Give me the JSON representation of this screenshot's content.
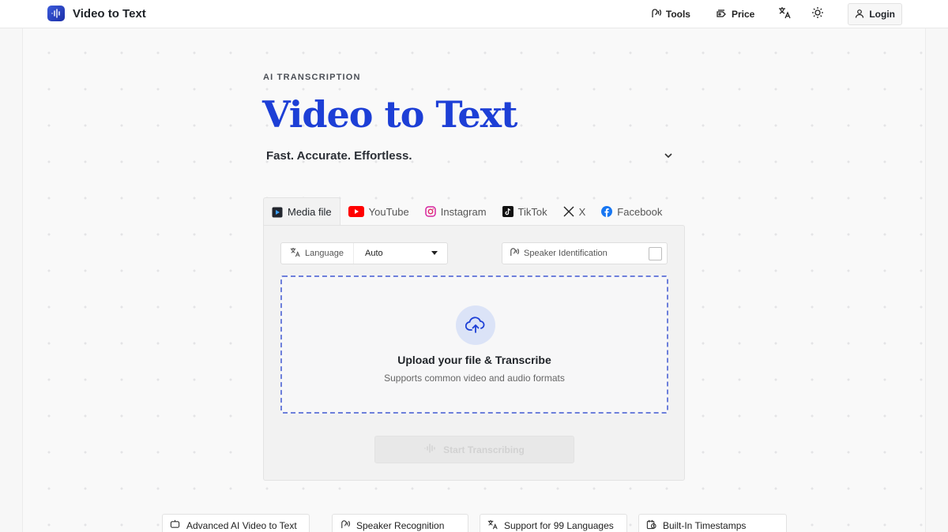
{
  "header": {
    "brand_name": "Video to Text",
    "nav": {
      "tools_label": "Tools",
      "price_label": "Price",
      "login_label": "Login"
    }
  },
  "hero": {
    "eyebrow": "AI TRANSCRIPTION",
    "title": "Video to Text",
    "tagline": "Fast. Accurate. Effortless."
  },
  "tabs": [
    {
      "label": "Media file",
      "icon": "media-file-icon",
      "active": true
    },
    {
      "label": "YouTube",
      "icon": "youtube-icon"
    },
    {
      "label": "Instagram",
      "icon": "instagram-icon"
    },
    {
      "label": "TikTok",
      "icon": "tiktok-icon"
    },
    {
      "label": "X",
      "icon": "x-icon"
    },
    {
      "label": "Facebook",
      "icon": "facebook-icon"
    }
  ],
  "panel": {
    "language_label": "Language",
    "language_value": "Auto",
    "speaker_label": "Speaker Identification",
    "speaker_checked": false,
    "upload_title": "Upload your file & Transcribe",
    "upload_subtitle": "Supports common video and audio formats",
    "start_label": "Start Transcribing"
  },
  "features": [
    {
      "label": "Advanced AI Video to Text",
      "icon": "ai-chat-icon"
    },
    {
      "label": "Speaker Recognition",
      "icon": "speaker-icon"
    },
    {
      "label": "Support for 99 Languages",
      "icon": "translate-icon"
    },
    {
      "label": "Built-In Timestamps",
      "icon": "timestamp-icon"
    }
  ],
  "colors": {
    "accent": "#1d3fd6",
    "youtube": "#ff0000",
    "facebook": "#1877f2",
    "dropzone_border": "#6d7fdb"
  }
}
